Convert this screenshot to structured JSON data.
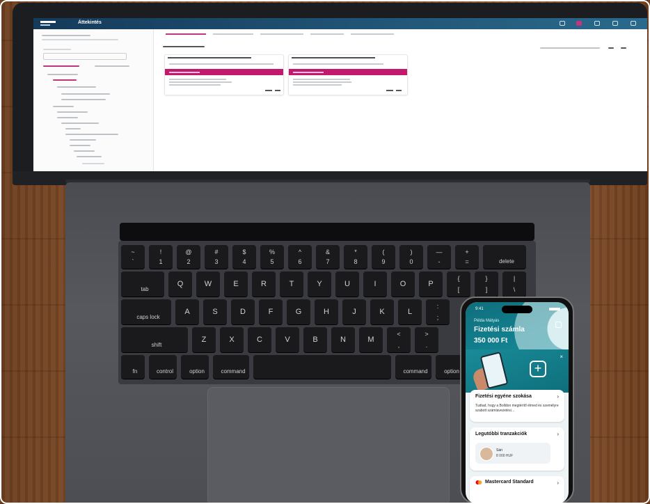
{
  "screen": {
    "brand": "Áttekintés"
  },
  "keyboard": {
    "rows": [
      [
        {
          "top": "~",
          "bot": "`"
        },
        {
          "top": "!",
          "bot": "1"
        },
        {
          "top": "@",
          "bot": "2"
        },
        {
          "top": "#",
          "bot": "3"
        },
        {
          "top": "$",
          "bot": "4"
        },
        {
          "top": "%",
          "bot": "5"
        },
        {
          "top": "^",
          "bot": "6"
        },
        {
          "top": "&",
          "bot": "7"
        },
        {
          "top": "*",
          "bot": "8"
        },
        {
          "top": "(",
          "bot": "9"
        },
        {
          "top": ")",
          "bot": "0"
        },
        {
          "top": "—",
          "bot": "-"
        },
        {
          "top": "+",
          "bot": "="
        },
        {
          "label": "delete"
        }
      ],
      [
        {
          "label": "tab"
        },
        {
          "top": "Q"
        },
        {
          "top": "W"
        },
        {
          "top": "E"
        },
        {
          "top": "R"
        },
        {
          "top": "T"
        },
        {
          "top": "Y"
        },
        {
          "top": "U"
        },
        {
          "top": "I"
        },
        {
          "top": "O"
        },
        {
          "top": "P"
        },
        {
          "top": "{",
          "bot": "["
        },
        {
          "top": "}",
          "bot": "]"
        },
        {
          "top": "|",
          "bot": "\\"
        }
      ],
      [
        {
          "label": "caps lock"
        },
        {
          "top": "A"
        },
        {
          "top": "S"
        },
        {
          "top": "D"
        },
        {
          "top": "F"
        },
        {
          "top": "G"
        },
        {
          "top": "H"
        },
        {
          "top": "J"
        },
        {
          "top": "K"
        },
        {
          "top": "L"
        },
        {
          "top": ":",
          "bot": ";"
        }
      ],
      [
        {
          "label": "shift"
        },
        {
          "top": "Z"
        },
        {
          "top": "X"
        },
        {
          "top": "C"
        },
        {
          "top": "V"
        },
        {
          "top": "B"
        },
        {
          "top": "N"
        },
        {
          "top": "M"
        },
        {
          "top": "<",
          "bot": ","
        },
        {
          "top": ">",
          "bot": "."
        }
      ],
      [
        {
          "label": "fn"
        },
        {
          "label": "control"
        },
        {
          "label": "option"
        },
        {
          "label": "command"
        },
        {
          "label": ""
        },
        {
          "label": "command"
        },
        {
          "label": "option"
        }
      ]
    ]
  },
  "phone": {
    "time": "9:41",
    "holder_name": "Példa Mátyás",
    "account_name": "Fizetési számla",
    "balance": "350 000 Ft",
    "promo_close": "×",
    "promo_plus": "+",
    "card_promo": {
      "title": "Fizetési egyéne szokása",
      "arrow": "›",
      "body": "Tudtad, hogy a Bolldon megtérítő élmed és személyre szabott számlavezetési…"
    },
    "card_tx": {
      "title": "Legutóbbi tranzakciók",
      "arrow": "›",
      "tx_name": "Sári",
      "tx_amount": "8 000 HUF"
    },
    "card_mc": {
      "title": "Mastercard Standard",
      "arrow": "›"
    },
    "colors": {
      "teal": "#148796",
      "accent_pink": "#c2186e"
    }
  }
}
